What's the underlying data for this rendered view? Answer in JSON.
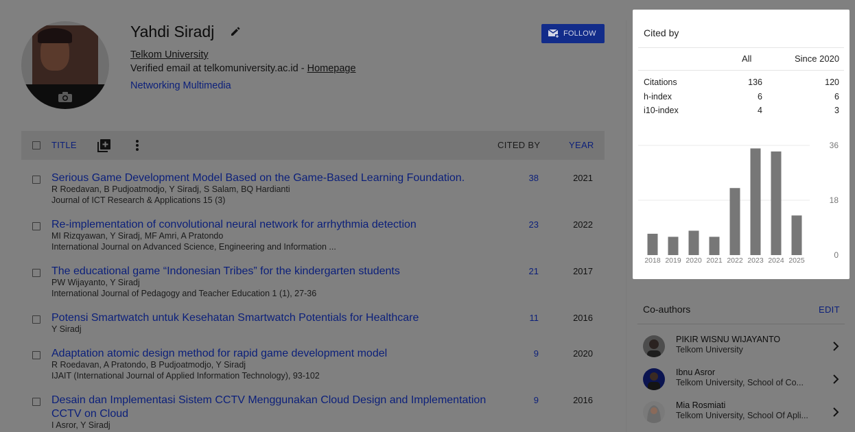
{
  "profile": {
    "name": "Yahdi Siradj",
    "affiliation": "Telkom University",
    "email_text": "Verified email at telkomuniversity.ac.id - ",
    "homepage_label": "Homepage",
    "interest": "Networking Multimedia",
    "follow_label": "FOLLOW"
  },
  "table": {
    "title_header": "TITLE",
    "cited_header": "CITED BY",
    "year_header": "YEAR",
    "rows": [
      {
        "title": "Serious Game Development Model Based on the Game-Based Learning Foundation.",
        "authors": "R Roedavan, B Pudjoatmodjo, Y Siradj, S Salam, BQ Hardianti",
        "venue": "Journal of ICT Research & Applications 15 (3)",
        "cited": "38",
        "year": "2021"
      },
      {
        "title": "Re-implementation of convolutional neural network for arrhythmia detection",
        "authors": "MI Rizqyawan, Y Siradj, MF Amri, A Pratondo",
        "venue": "International Journal on Advanced Science, Engineering and Information ...",
        "cited": "23",
        "year": "2022"
      },
      {
        "title": "The educational game “Indonesian Tribes” for the kindergarten students",
        "authors": "PW Wijayanto, Y Siradj",
        "venue": "International Journal of Pedagogy and Teacher Education 1 (1), 27-36",
        "cited": "21",
        "year": "2017"
      },
      {
        "title": "Potensi Smartwatch untuk Kesehatan Smartwatch Potentials for Healthcare",
        "authors": "Y Siradj",
        "venue": "",
        "cited": "11",
        "year": "2016"
      },
      {
        "title": "Adaptation atomic design method for rapid game development model",
        "authors": "R Roedavan, A Pratondo, B Pudjoatmodjo, Y Siradj",
        "venue": "IJAIT (International Journal of Applied Information Technology), 93-102",
        "cited": "9",
        "year": "2020"
      },
      {
        "title": "Desain dan Implementasi Sistem CCTV Menggunakan Cloud Design and Implementation CCTV on Cloud",
        "authors": "I Asror, Y Siradj",
        "venue": "",
        "cited": "9",
        "year": "2016"
      }
    ]
  },
  "cited_by": {
    "title": "Cited by",
    "col_all": "All",
    "col_since": "Since 2020",
    "metrics": [
      {
        "label": "Citations",
        "all": "136",
        "since": "120"
      },
      {
        "label": "h-index",
        "all": "6",
        "since": "6"
      },
      {
        "label": "i10-index",
        "all": "4",
        "since": "3"
      }
    ]
  },
  "chart_data": {
    "type": "bar",
    "categories": [
      "2018",
      "2019",
      "2020",
      "2021",
      "2022",
      "2023",
      "2024",
      "2025"
    ],
    "values": [
      7,
      6,
      8,
      6,
      22,
      35,
      34,
      13
    ],
    "ylim": [
      0,
      36
    ],
    "yticks": [
      "0",
      "18",
      "36"
    ],
    "bar_color": "#777777"
  },
  "coauthors": {
    "title": "Co-authors",
    "edit_label": "EDIT",
    "items": [
      {
        "name": "PIKIR WISNU WIJAYANTO",
        "affiliation": "Telkom University"
      },
      {
        "name": "Ibnu Asror",
        "affiliation": "Telkom University, School of Co..."
      },
      {
        "name": "Mia Rosmiati",
        "affiliation": "Telkom University, School Of Apli..."
      }
    ]
  }
}
